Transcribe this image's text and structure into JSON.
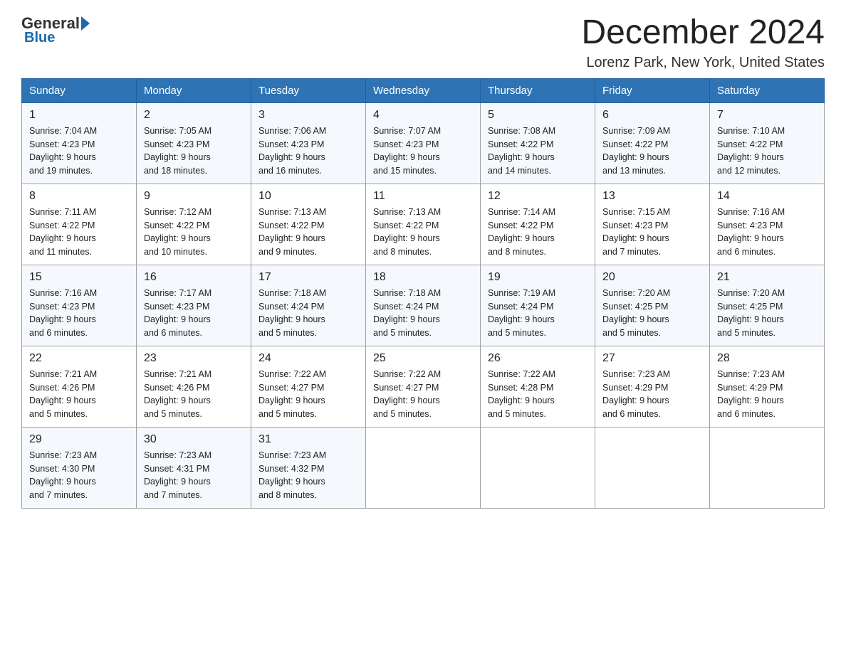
{
  "header": {
    "logo_general": "General",
    "logo_blue": "Blue",
    "month_title": "December 2024",
    "location": "Lorenz Park, New York, United States"
  },
  "days_of_week": [
    "Sunday",
    "Monday",
    "Tuesday",
    "Wednesday",
    "Thursday",
    "Friday",
    "Saturday"
  ],
  "weeks": [
    [
      {
        "day": "1",
        "sunrise": "7:04 AM",
        "sunset": "4:23 PM",
        "daylight": "9 hours and 19 minutes."
      },
      {
        "day": "2",
        "sunrise": "7:05 AM",
        "sunset": "4:23 PM",
        "daylight": "9 hours and 18 minutes."
      },
      {
        "day": "3",
        "sunrise": "7:06 AM",
        "sunset": "4:23 PM",
        "daylight": "9 hours and 16 minutes."
      },
      {
        "day": "4",
        "sunrise": "7:07 AM",
        "sunset": "4:23 PM",
        "daylight": "9 hours and 15 minutes."
      },
      {
        "day": "5",
        "sunrise": "7:08 AM",
        "sunset": "4:22 PM",
        "daylight": "9 hours and 14 minutes."
      },
      {
        "day": "6",
        "sunrise": "7:09 AM",
        "sunset": "4:22 PM",
        "daylight": "9 hours and 13 minutes."
      },
      {
        "day": "7",
        "sunrise": "7:10 AM",
        "sunset": "4:22 PM",
        "daylight": "9 hours and 12 minutes."
      }
    ],
    [
      {
        "day": "8",
        "sunrise": "7:11 AM",
        "sunset": "4:22 PM",
        "daylight": "9 hours and 11 minutes."
      },
      {
        "day": "9",
        "sunrise": "7:12 AM",
        "sunset": "4:22 PM",
        "daylight": "9 hours and 10 minutes."
      },
      {
        "day": "10",
        "sunrise": "7:13 AM",
        "sunset": "4:22 PM",
        "daylight": "9 hours and 9 minutes."
      },
      {
        "day": "11",
        "sunrise": "7:13 AM",
        "sunset": "4:22 PM",
        "daylight": "9 hours and 8 minutes."
      },
      {
        "day": "12",
        "sunrise": "7:14 AM",
        "sunset": "4:22 PM",
        "daylight": "9 hours and 8 minutes."
      },
      {
        "day": "13",
        "sunrise": "7:15 AM",
        "sunset": "4:23 PM",
        "daylight": "9 hours and 7 minutes."
      },
      {
        "day": "14",
        "sunrise": "7:16 AM",
        "sunset": "4:23 PM",
        "daylight": "9 hours and 6 minutes."
      }
    ],
    [
      {
        "day": "15",
        "sunrise": "7:16 AM",
        "sunset": "4:23 PM",
        "daylight": "9 hours and 6 minutes."
      },
      {
        "day": "16",
        "sunrise": "7:17 AM",
        "sunset": "4:23 PM",
        "daylight": "9 hours and 6 minutes."
      },
      {
        "day": "17",
        "sunrise": "7:18 AM",
        "sunset": "4:24 PM",
        "daylight": "9 hours and 5 minutes."
      },
      {
        "day": "18",
        "sunrise": "7:18 AM",
        "sunset": "4:24 PM",
        "daylight": "9 hours and 5 minutes."
      },
      {
        "day": "19",
        "sunrise": "7:19 AM",
        "sunset": "4:24 PM",
        "daylight": "9 hours and 5 minutes."
      },
      {
        "day": "20",
        "sunrise": "7:20 AM",
        "sunset": "4:25 PM",
        "daylight": "9 hours and 5 minutes."
      },
      {
        "day": "21",
        "sunrise": "7:20 AM",
        "sunset": "4:25 PM",
        "daylight": "9 hours and 5 minutes."
      }
    ],
    [
      {
        "day": "22",
        "sunrise": "7:21 AM",
        "sunset": "4:26 PM",
        "daylight": "9 hours and 5 minutes."
      },
      {
        "day": "23",
        "sunrise": "7:21 AM",
        "sunset": "4:26 PM",
        "daylight": "9 hours and 5 minutes."
      },
      {
        "day": "24",
        "sunrise": "7:22 AM",
        "sunset": "4:27 PM",
        "daylight": "9 hours and 5 minutes."
      },
      {
        "day": "25",
        "sunrise": "7:22 AM",
        "sunset": "4:27 PM",
        "daylight": "9 hours and 5 minutes."
      },
      {
        "day": "26",
        "sunrise": "7:22 AM",
        "sunset": "4:28 PM",
        "daylight": "9 hours and 5 minutes."
      },
      {
        "day": "27",
        "sunrise": "7:23 AM",
        "sunset": "4:29 PM",
        "daylight": "9 hours and 6 minutes."
      },
      {
        "day": "28",
        "sunrise": "7:23 AM",
        "sunset": "4:29 PM",
        "daylight": "9 hours and 6 minutes."
      }
    ],
    [
      {
        "day": "29",
        "sunrise": "7:23 AM",
        "sunset": "4:30 PM",
        "daylight": "9 hours and 7 minutes."
      },
      {
        "day": "30",
        "sunrise": "7:23 AM",
        "sunset": "4:31 PM",
        "daylight": "9 hours and 7 minutes."
      },
      {
        "day": "31",
        "sunrise": "7:23 AM",
        "sunset": "4:32 PM",
        "daylight": "9 hours and 8 minutes."
      },
      null,
      null,
      null,
      null
    ]
  ]
}
